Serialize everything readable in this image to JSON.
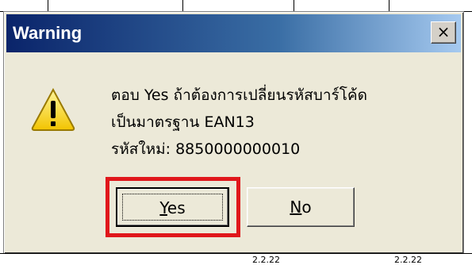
{
  "dialog": {
    "title": "Warning",
    "close_glyph": "×",
    "icon": "warning-triangle-icon",
    "message_lines": [
      "ตอบ Yes ถ้าต้องการเปลี่ยนรหัสบาร์โค้ด",
      "เป็นมาตรฐาน EAN13",
      "รหัสใหม่: 8850000000010"
    ],
    "buttons": {
      "yes_mnemonic": "Y",
      "yes_rest": "es",
      "no_mnemonic": "N",
      "no_rest": "o"
    },
    "highlighted_button": "Yes",
    "colors": {
      "titlebar_start": "#0a246a",
      "titlebar_end": "#a6caf0",
      "highlight": "#e0171b",
      "face": "#ece9d8"
    }
  },
  "background_sheet": {
    "bottom_row_fragments": [
      "2.2.22",
      "2.2.22"
    ]
  }
}
